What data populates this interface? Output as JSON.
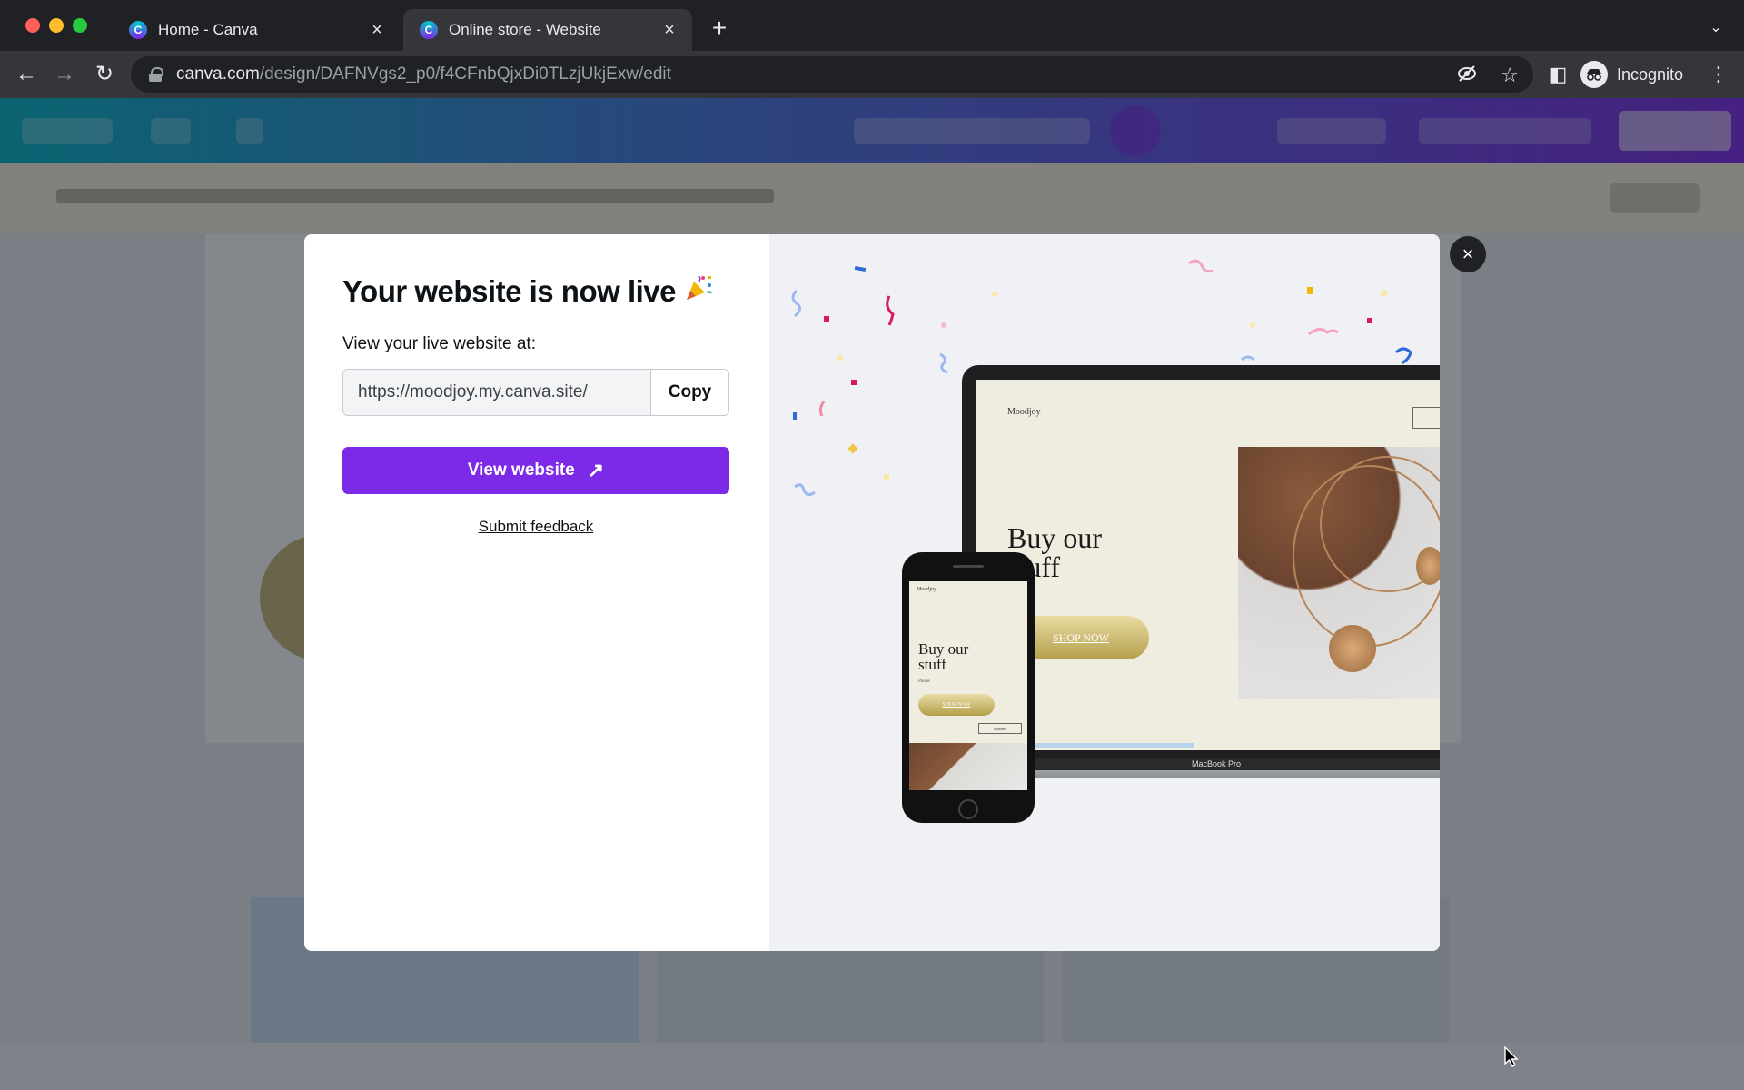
{
  "browser": {
    "tabs": [
      {
        "title": "Home - Canva",
        "active": false
      },
      {
        "title": "Online store - Website",
        "active": true
      }
    ],
    "url_host": "canva.com",
    "url_path": "/design/DAFNVgs2_p0/f4CFnbQjxDi0TLzjUkjExw/edit",
    "profile_label": "Incognito",
    "new_tab_symbol": "+",
    "tab_close_symbol": "×"
  },
  "modal": {
    "title": "Your website is now live",
    "title_icon": "party-popper-icon",
    "live_label": "View your live website at:",
    "site_url": "https://moodjoy.my.canva.site/",
    "copy_label": "Copy",
    "view_label": "View website",
    "feedback_label": "Submit feedback",
    "close_symbol": "×"
  },
  "preview": {
    "laptop": {
      "logo": "Moodjoy",
      "headline_line1": "Buy our",
      "headline_line2": "stuff",
      "sub": "se",
      "shop_label": "SHOP NOW",
      "device_label": "MacBook Pro"
    },
    "phone": {
      "logo": "Moodjoy",
      "headline_line1": "Buy our",
      "headline_line2": "stuff",
      "sub": "Please",
      "shop_label": "SHOP NOW",
      "button2_label": "Bottoms"
    }
  },
  "colors": {
    "accent_purple": "#7d2ae8",
    "header_teal": "#02b6c7",
    "modal_dark": "#0d1216",
    "overlay": "rgba(20,24,34,0.52)"
  }
}
